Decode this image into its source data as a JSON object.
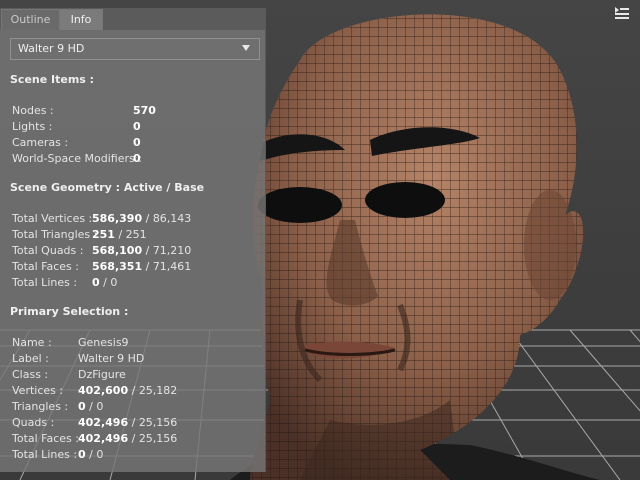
{
  "tabs": [
    "Outline",
    "Info"
  ],
  "figure_select": "Walter 9 HD",
  "scene_items": {
    "heading": "Scene Items :",
    "rows": [
      {
        "label": "Nodes :",
        "value": "570"
      },
      {
        "label": "Lights :",
        "value": "0"
      },
      {
        "label": "Cameras :",
        "value": "0"
      },
      {
        "label": "World-Space Modifiers :",
        "value": "0"
      }
    ]
  },
  "scene_geometry": {
    "heading": "Scene Geometry : Active / Base",
    "rows": [
      {
        "label": "Total Vertices :",
        "active": "586,390",
        "base": "86,143"
      },
      {
        "label": "Total Triangles :",
        "active": "251",
        "base": "251"
      },
      {
        "label": "Total Quads :",
        "active": "568,100",
        "base": "71,210"
      },
      {
        "label": "Total Faces :",
        "active": "568,351",
        "base": "71,461"
      },
      {
        "label": "Total Lines :",
        "active": "0",
        "base": "0"
      }
    ]
  },
  "primary_selection": {
    "heading": "Primary Selection :",
    "rows": [
      {
        "label": "Name :",
        "value": "Genesis9"
      },
      {
        "label": "Label :",
        "value": "Walter 9 HD"
      },
      {
        "label": "Class :",
        "value": "DzFigure"
      },
      {
        "label": "Vertices :",
        "active": "402,600",
        "base": "25,182"
      },
      {
        "label": "Triangles :",
        "active": "0",
        "base": "0"
      },
      {
        "label": "Quads :",
        "active": "402,496",
        "base": "25,156"
      },
      {
        "label": "Total Faces :",
        "active": "402,496",
        "base": "25,156"
      },
      {
        "label": "Total Lines :",
        "active": "0",
        "base": "0"
      }
    ]
  },
  "separator": " / ",
  "viewport": {
    "menu_icon": "viewport-menu-icon",
    "skin_color": "#9a6a52",
    "wire_color": "#2a1c16"
  }
}
